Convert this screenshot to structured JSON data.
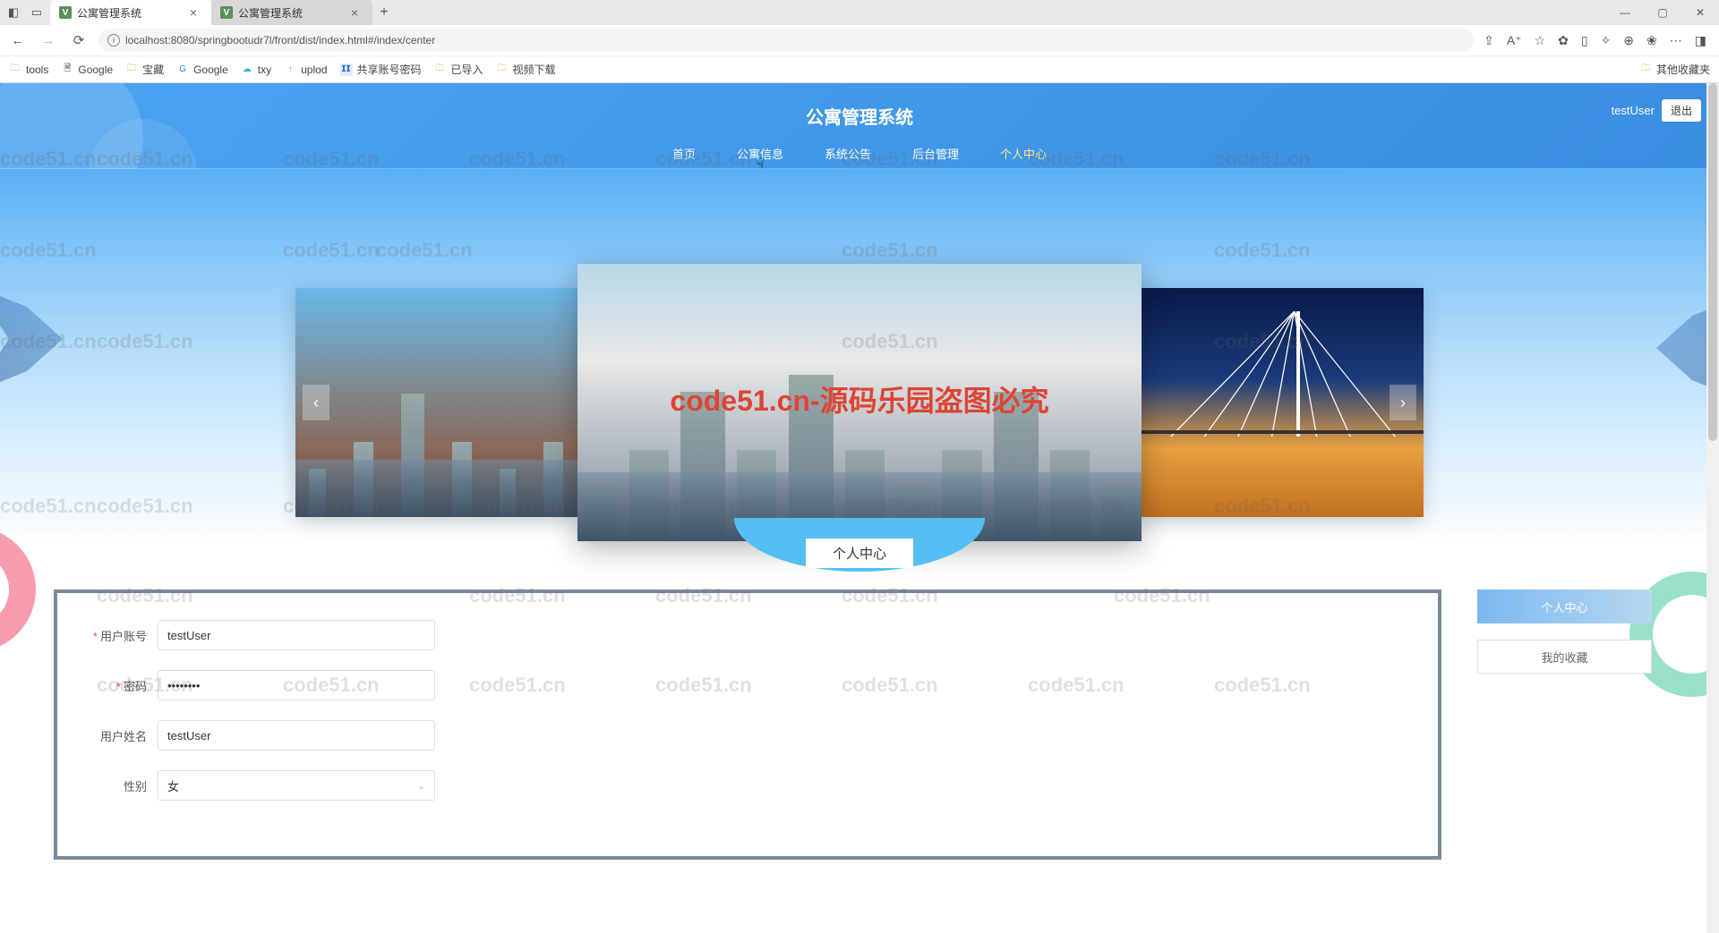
{
  "browser": {
    "tabs": [
      {
        "title": "公寓管理系统",
        "active": true
      },
      {
        "title": "公寓管理系统",
        "active": false
      }
    ],
    "url": "localhost:8080/springbootudr7l/front/dist/index.html#/index/center",
    "bookmarks": [
      "tools",
      "Google",
      "宝藏",
      "Google",
      "txy",
      "uplod",
      "共享账号密码",
      "已导入",
      "视频下载"
    ],
    "other_bookmarks": "其他收藏夹"
  },
  "header": {
    "title": "公寓管理系统",
    "user": "testUser",
    "logout": "退出",
    "nav": [
      "首页",
      "公寓信息",
      "系统公告",
      "后台管理",
      "个人中心"
    ],
    "active_nav": "个人中心"
  },
  "section_title": "个人中心",
  "form": {
    "fields": [
      {
        "label": "用户账号",
        "value": "testUser",
        "required": true,
        "type": "text"
      },
      {
        "label": "密码",
        "value": "••••••••",
        "required": true,
        "type": "password"
      },
      {
        "label": "用户姓名",
        "value": "testUser",
        "required": false,
        "type": "text"
      },
      {
        "label": "性别",
        "value": "女",
        "required": false,
        "type": "select"
      }
    ]
  },
  "side": {
    "items": [
      {
        "label": "个人中心",
        "active": true
      },
      {
        "label": "我的收藏",
        "active": false
      }
    ]
  },
  "watermark": {
    "text": "code51.cn",
    "red": "code51.cn-源码乐园盗图必究"
  }
}
